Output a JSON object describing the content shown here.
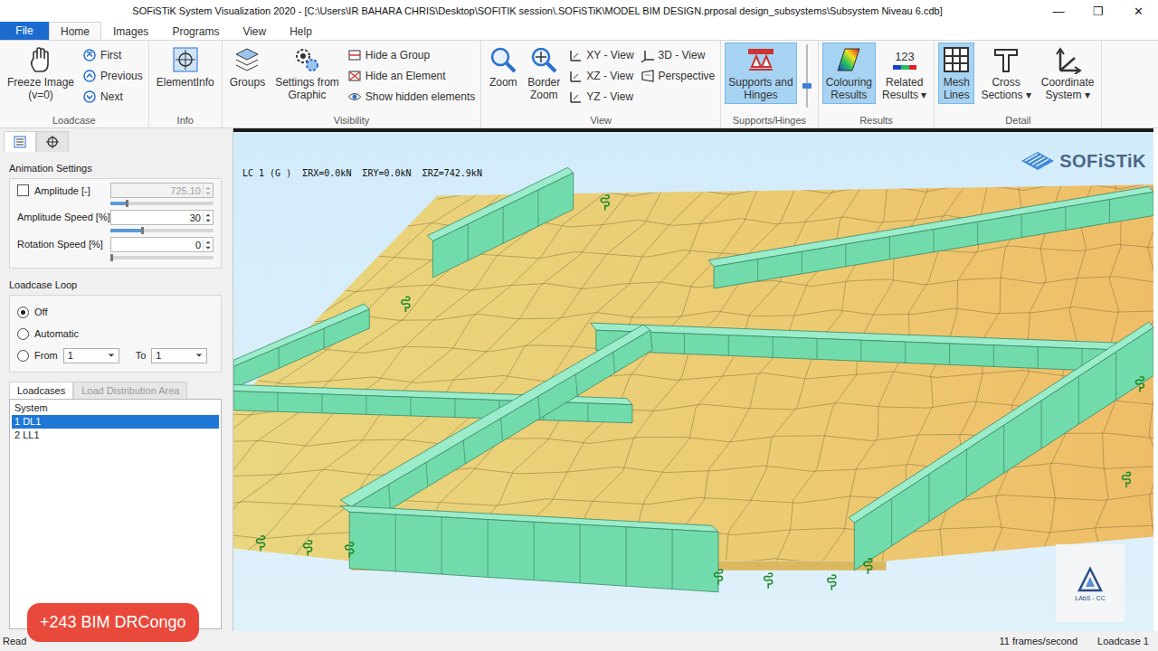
{
  "window": {
    "title": "SOFiSTiK System Visualization 2020 - [C:\\Users\\IR BAHARA CHRIS\\Desktop\\SOFITIK session\\.SOFiSTiK\\MODEL BIM DESIGN.prposal design_subsystems\\Subsystem Niveau 6.cdb]",
    "controls": [
      "—",
      "❐",
      "✕"
    ]
  },
  "menu": [
    {
      "label": "File",
      "kind": "file",
      "selected": false
    },
    {
      "label": "Home",
      "kind": "tab",
      "selected": true
    },
    {
      "label": "Images",
      "kind": "tab",
      "selected": false
    },
    {
      "label": "Programs",
      "kind": "tab",
      "selected": false
    },
    {
      "label": "View",
      "kind": "tab",
      "selected": false
    },
    {
      "label": "Help",
      "kind": "tab",
      "selected": false
    }
  ],
  "ribbon": [
    {
      "name": "Loadcase",
      "columns": [
        {
          "kind": "large",
          "items": [
            {
              "lines": [
                "Freeze Image",
                "(v=0)"
              ],
              "selected": false
            }
          ]
        },
        {
          "kind": "small",
          "items": [
            {
              "lines": [
                "First"
              ],
              "selected": false
            },
            {
              "lines": [
                "Previous"
              ],
              "selected": false
            },
            {
              "lines": [
                "Next"
              ],
              "selected": false
            }
          ]
        }
      ]
    },
    {
      "name": "Info",
      "columns": [
        {
          "kind": "large",
          "items": [
            {
              "lines": [
                "ElementInfo"
              ],
              "selected": false
            }
          ]
        }
      ]
    },
    {
      "name": "Visibility",
      "columns": [
        {
          "kind": "large",
          "items": [
            {
              "lines": [
                "Groups"
              ],
              "selected": false
            }
          ]
        },
        {
          "kind": "large",
          "items": [
            {
              "lines": [
                "Settings from",
                "Graphic"
              ],
              "selected": false
            }
          ]
        },
        {
          "kind": "small",
          "items": [
            {
              "lines": [
                "Hide a Group"
              ],
              "selected": false
            },
            {
              "lines": [
                "Hide an Element"
              ],
              "selected": false
            },
            {
              "lines": [
                "Show hidden elements"
              ],
              "selected": false
            }
          ]
        }
      ]
    },
    {
      "name": "View",
      "columns": [
        {
          "kind": "large",
          "items": [
            {
              "lines": [
                "Zoom"
              ],
              "selected": false
            }
          ]
        },
        {
          "kind": "large",
          "items": [
            {
              "lines": [
                "Border",
                "Zoom"
              ],
              "selected": false
            }
          ]
        },
        {
          "kind": "small",
          "items": [
            {
              "lines": [
                "XY - View"
              ],
              "selected": false
            },
            {
              "lines": [
                "XZ - View"
              ],
              "selected": false
            },
            {
              "lines": [
                "YZ - View"
              ],
              "selected": false
            }
          ]
        },
        {
          "kind": "small",
          "items": [
            {
              "lines": [
                "3D - View"
              ],
              "selected": false
            },
            {
              "lines": [
                "Perspective"
              ],
              "selected": false
            }
          ]
        }
      ]
    },
    {
      "name": "Supports/Hinges",
      "columns": [
        {
          "kind": "large",
          "items": [
            {
              "lines": [
                "Supports and",
                "Hinges"
              ],
              "selected": true
            }
          ]
        },
        {
          "kind": "slider",
          "level": 0.35,
          "items": []
        }
      ]
    },
    {
      "name": "Results",
      "columns": [
        {
          "kind": "large",
          "items": [
            {
              "lines": [
                "Colouring",
                "Results"
              ],
              "selected": true
            }
          ]
        },
        {
          "kind": "large",
          "items": [
            {
              "lines": [
                "Related",
                "Results ▾"
              ],
              "selected": false,
              "icon_text": "123"
            }
          ]
        }
      ]
    },
    {
      "name": "Detail",
      "columns": [
        {
          "kind": "large",
          "items": [
            {
              "lines": [
                "Mesh",
                "Lines"
              ],
              "selected": true
            }
          ]
        },
        {
          "kind": "large",
          "items": [
            {
              "lines": [
                "Cross",
                "Sections ▾"
              ],
              "selected": false
            }
          ]
        },
        {
          "kind": "large",
          "items": [
            {
              "lines": [
                "Coordinate",
                "System ▾"
              ],
              "selected": false
            }
          ]
        }
      ]
    }
  ],
  "panel": {
    "tabs": [
      {
        "selected": true
      },
      {
        "selected": false
      }
    ],
    "animation": {
      "title": "Animation Settings",
      "rows": [
        {
          "label": "Amplitude [-]",
          "kind": "checkbox",
          "checked": false,
          "value": "725.10",
          "disabled": true,
          "level": 0.15
        },
        {
          "label": "Amplitude Speed [%]",
          "kind": "plain",
          "checked": false,
          "value": "30",
          "disabled": false,
          "level": 0.3
        },
        {
          "label": "Rotation Speed [%]",
          "kind": "plain",
          "checked": false,
          "value": "0",
          "disabled": false,
          "level": 0
        }
      ]
    },
    "loop": {
      "title": "Loadcase Loop",
      "options": [
        {
          "label": "Off",
          "selected": true,
          "kind": "plain"
        },
        {
          "label": "Automatic",
          "selected": false,
          "kind": "plain"
        },
        {
          "label": "From",
          "selected": false,
          "kind": "range"
        }
      ],
      "from": "1",
      "to_label": "To",
      "to": "1"
    },
    "list_tabs": [
      {
        "label": "Loadcases",
        "selected": true,
        "disabled": false
      },
      {
        "label": "Load Distribution Area",
        "selected": false,
        "disabled": true
      }
    ],
    "loadcases": [
      {
        "label": "System",
        "selected": false
      },
      {
        "label": "1 DL1",
        "selected": true
      },
      {
        "label": "2 LL1",
        "selected": false
      }
    ]
  },
  "viewport": {
    "label": "LC 1 (G )  ΣRX=0.0kN  ΣRY=0.0kN  ΣRZ=742.9kN",
    "brand": "SOFiSTiK",
    "watermark": "LAbS - CC"
  },
  "status_bar": {
    "left": "Read",
    "fps": "11 frames/second",
    "loadcase": "Loadcase 1"
  },
  "badge": "+243 BIM DRCongo"
}
